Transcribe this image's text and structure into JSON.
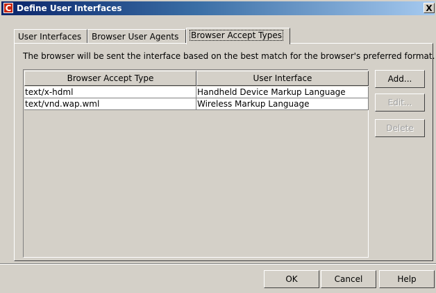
{
  "window": {
    "title": "Define User Interfaces",
    "close_label": "X",
    "icon_letter": "C"
  },
  "tabs": [
    {
      "label": "User Interfaces",
      "active": false
    },
    {
      "label": "Browser User Agents",
      "active": false
    },
    {
      "label": "Browser Accept Types",
      "active": true
    }
  ],
  "description": "The browser will be sent the interface based on the best match for the browser's preferred format.",
  "table": {
    "columns": [
      "Browser Accept Type",
      "User Interface"
    ],
    "rows": [
      [
        "text/x-hdml",
        "Handheld Device Markup Language"
      ],
      [
        "text/vnd.wap.wml",
        "Wireless Markup Language"
      ]
    ]
  },
  "side_buttons": {
    "add": "Add...",
    "edit": "Edit...",
    "delete": "Delete"
  },
  "footer_buttons": {
    "ok": "OK",
    "cancel": "Cancel",
    "help": "Help"
  },
  "colors": {
    "dialog_bg": "#d4d0c8",
    "title_start": "#0a246a",
    "title_end": "#a6caf0",
    "icon_red": "#c8240e"
  }
}
